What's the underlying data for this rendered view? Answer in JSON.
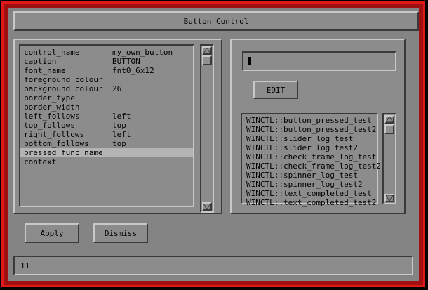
{
  "window": {
    "title": "Button Control"
  },
  "properties": [
    {
      "key": "control_name",
      "value": "my_own_button"
    },
    {
      "key": "caption",
      "value": "BUTTON"
    },
    {
      "key": "font_name",
      "value": "fnt0_6x12"
    },
    {
      "key": "foreground_colour",
      "value": ""
    },
    {
      "key": "background_colour",
      "value": "26"
    },
    {
      "key": "border_type",
      "value": ""
    },
    {
      "key": "border_width",
      "value": ""
    },
    {
      "key": "left_follows",
      "value": "left"
    },
    {
      "key": "top_follows",
      "value": "top"
    },
    {
      "key": "right_follows",
      "value": "left"
    },
    {
      "key": "bottom_follows",
      "value": "top"
    },
    {
      "key": "pressed_func_name",
      "value": ""
    },
    {
      "key": "context",
      "value": ""
    }
  ],
  "selected_property_index": 11,
  "editor": {
    "value": "",
    "edit_label": "EDIT"
  },
  "functions": [
    "WINCTL::button_pressed_test",
    "WINCTL::button_pressed_test2",
    "WINCTL::slider_log_test",
    "WINCTL::slider_log_test2",
    "WINCTL::check_frame_log_test",
    "WINCTL::check_frame_log_test2",
    "WINCTL::spinner_log_test",
    "WINCTL::spinner_log_test2",
    "WINCTL::text_completed_test",
    "WINCTL::text_completed_test2"
  ],
  "buttons": {
    "apply": "Apply",
    "dismiss": "Dismiss"
  },
  "status": {
    "text": "11"
  },
  "colors": {
    "frame_red": "#e01818",
    "panel_gray": "#8c8c8c",
    "selection": "#b4b4b4"
  }
}
